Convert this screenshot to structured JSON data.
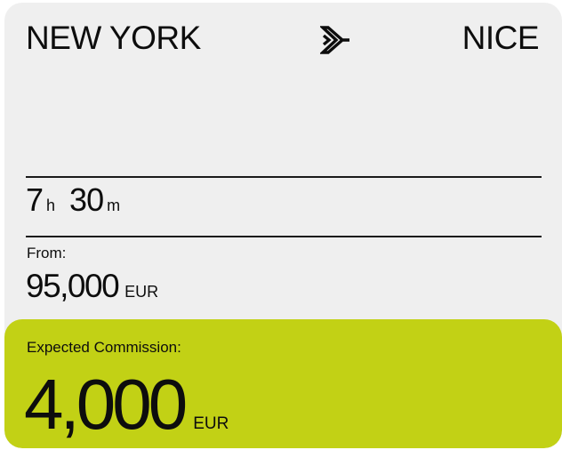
{
  "route": {
    "origin": "NEW YORK",
    "destination": "NICE",
    "icon": "airplane-icon"
  },
  "duration": {
    "hours": "7",
    "hours_unit": "h",
    "minutes": "30",
    "minutes_unit": "m"
  },
  "price": {
    "label": "From:",
    "value": "95,000",
    "currency": "EUR"
  },
  "commission": {
    "label": "Expected Commission:",
    "value": "4,000",
    "currency": "EUR"
  },
  "colors": {
    "card_background": "#efefef",
    "commission_background": "#c2d115",
    "text": "#0d0d0d"
  }
}
